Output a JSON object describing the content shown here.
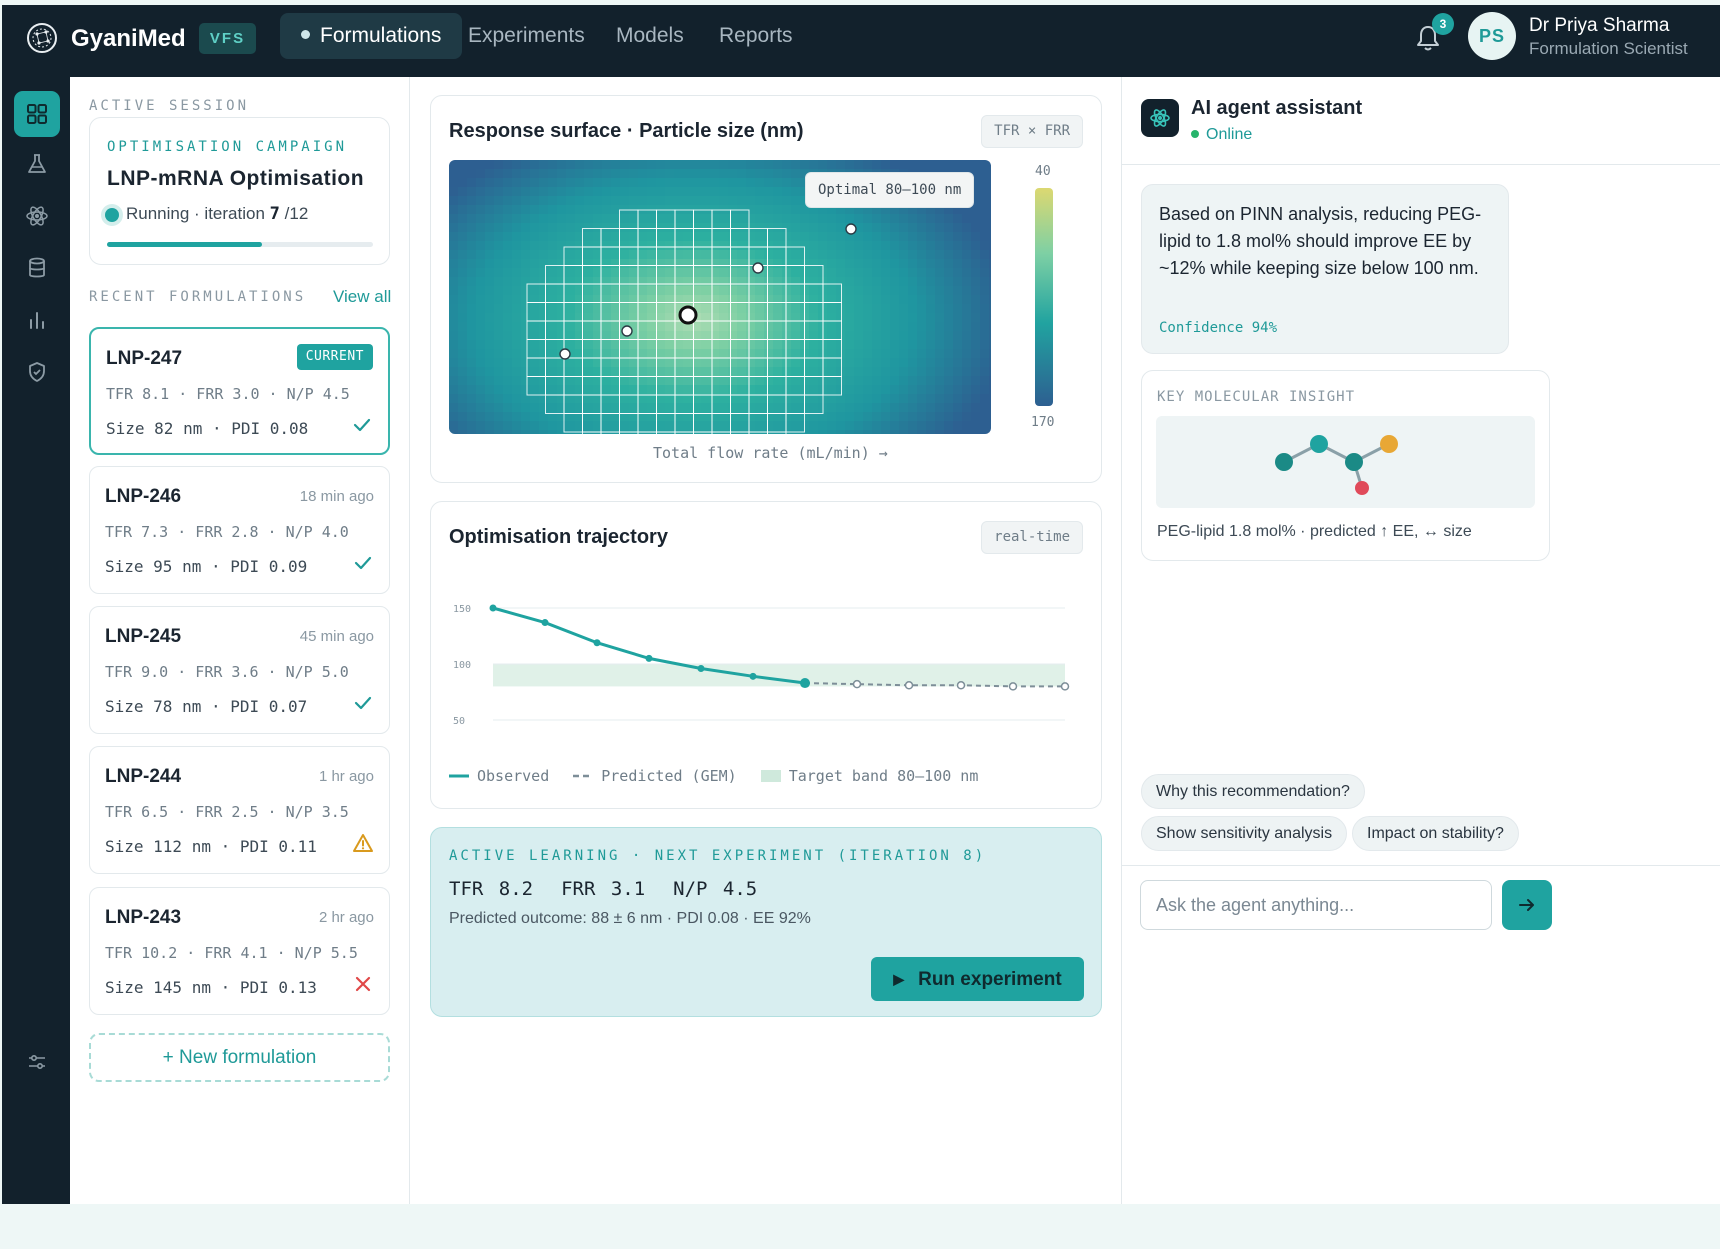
{
  "app": {
    "brand": "GyaniMed",
    "badge": "VFS"
  },
  "nav": [
    {
      "label": "Formulations",
      "active": true
    },
    {
      "label": "Experiments",
      "active": false
    },
    {
      "label": "Models",
      "active": false
    },
    {
      "label": "Reports",
      "active": false
    }
  ],
  "user": {
    "notifications": "3",
    "initials": "PS",
    "name": "Dr Priya Sharma",
    "role": "Formulation Scientist"
  },
  "rail": [
    "dashboard-icon",
    "flask-icon",
    "atom-icon",
    "database-icon",
    "bar-chart-icon",
    "shield-check-icon",
    "sliders-icon"
  ],
  "session": {
    "section_label": "ACTIVE SESSION",
    "campaign_label": "OPTIMISATION CAMPAIGN",
    "campaign_name": "LNP-mRNA Optimisation",
    "status_prefix": "Running · iteration",
    "iteration": "7",
    "iteration_total": "/12",
    "progress": 0.583
  },
  "recent": {
    "section_label": "RECENT FORMULATIONS",
    "view_all": "View all",
    "items": [
      {
        "name": "LNP-247",
        "badge": "CURRENT",
        "time": "",
        "params": "TFR 8.1 · FRR 3.0 · N/P 4.5",
        "size": "Size 82 nm · PDI 0.08",
        "status": "check"
      },
      {
        "name": "LNP-246",
        "badge": "",
        "time": "18 min ago",
        "params": "TFR 7.3 · FRR 2.8 · N/P 4.0",
        "size": "Size 95 nm · PDI 0.09",
        "status": "check"
      },
      {
        "name": "LNP-245",
        "badge": "",
        "time": "45 min ago",
        "params": "TFR 9.0 · FRR 3.6 · N/P 5.0",
        "size": "Size 78 nm · PDI 0.07",
        "status": "check"
      },
      {
        "name": "LNP-244",
        "badge": "",
        "time": "1 hr ago",
        "params": "TFR 6.5 · FRR 2.5 · N/P 3.5",
        "size": "Size 112 nm · PDI 0.11",
        "status": "warning"
      },
      {
        "name": "LNP-243",
        "badge": "",
        "time": "2 hr ago",
        "params": "TFR 10.2 · FRR 4.1 · N/P 5.5",
        "size": "Size 145 nm · PDI 0.13",
        "status": "fail"
      }
    ],
    "new_button": "+ New formulation"
  },
  "surface": {
    "title": "Response surface · Particle size (nm)",
    "chip": "TFR × FRR",
    "tooltip": "Optimal 80–100 nm",
    "xlabel": "Total flow rate (mL/min) →",
    "colorbar_top": "40",
    "colorbar_bottom": "170"
  },
  "trajectory": {
    "title": "Optimisation trajectory",
    "chip": "real-time",
    "legend": {
      "observed": "Observed",
      "predicted": "Predicted (GEM)",
      "band": "Target band 80–100 nm"
    }
  },
  "chart_data": {
    "type": "line",
    "title": "Optimisation trajectory",
    "x": [
      1,
      2,
      3,
      4,
      5,
      6,
      7,
      8,
      9,
      10,
      11,
      12
    ],
    "series": [
      {
        "name": "Observed",
        "x": [
          1,
          2,
          3,
          4,
          5,
          6,
          7
        ],
        "values": [
          150,
          137,
          119,
          105,
          96,
          89,
          83
        ]
      },
      {
        "name": "Predicted (GEM)",
        "x": [
          7,
          8,
          9,
          10,
          11,
          12
        ],
        "values": [
          83,
          82,
          81,
          81,
          80,
          80
        ]
      }
    ],
    "band": {
      "name": "Target band 80–100 nm",
      "low": 80,
      "high": 100
    },
    "yticks": [
      "150",
      "100",
      "50"
    ],
    "ylim": [
      50,
      150
    ],
    "grid": true,
    "legend_position": "bottom-left"
  },
  "next": {
    "label": "ACTIVE LEARNING · NEXT EXPERIMENT (ITERATION 8)",
    "tfr": "TFR 8.2",
    "frr": "FRR 3.1",
    "np": "N/P 4.5",
    "outcome": "Predicted outcome: 88 ± 6 nm · PDI 0.08 · EE 92%",
    "run_label": "Run experiment"
  },
  "agent": {
    "title": "AI agent assistant",
    "status": "Online",
    "message": "Based on PINN analysis, reducing PEG-lipid to 1.8 mol% should improve EE by ~12% while keeping size below 100 nm.",
    "confidence": "Confidence 94%",
    "insight_label": "KEY MOLECULAR INSIGHT",
    "insight_text": "PEG-lipid 1.8 mol% · predicted ↑ EE, ↔ size",
    "suggestions": [
      "Why this recommendation?",
      "Show sensitivity analysis",
      "Impact on stability?"
    ],
    "input_placeholder": "Ask the agent anything...",
    "colors": {
      "accent": "#1fa3a0",
      "dark": "#12212c",
      "warning": "#d99a1e",
      "error": "#e04848",
      "node_orange": "#e8a735",
      "node_red": "#e04a5a"
    }
  }
}
